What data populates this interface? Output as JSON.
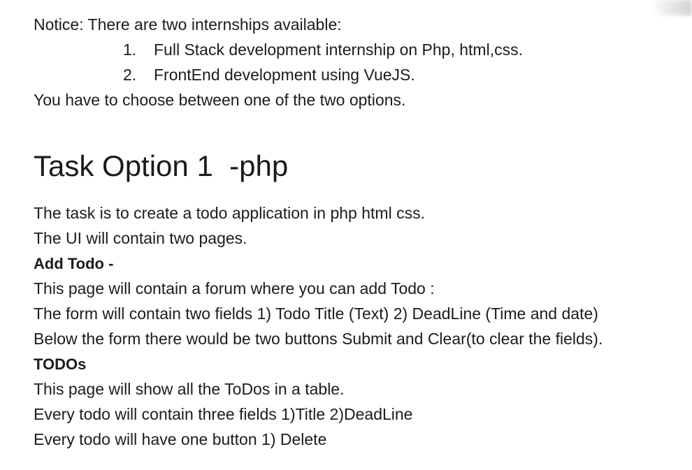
{
  "notice": {
    "intro": "Notice: There are two internships available:",
    "options": [
      {
        "number": "1.",
        "text": "Full Stack development internship on Php, html,css."
      },
      {
        "number": "2.",
        "text": "FrontEnd development using VueJS."
      }
    ],
    "choose": "You have to choose between one of the two options."
  },
  "task": {
    "heading": "Task Option 1  -php",
    "intro_lines": [
      "The task is to create a todo application in php html css.",
      "The UI will contain two pages."
    ],
    "add_todo": {
      "title": "Add Todo -",
      "lines": [
        "This page will contain a forum where you can add Todo :",
        "The form will contain two fields 1) Todo Title (Text) 2) DeadLine (Time and date)",
        "Below the form there would be two buttons Submit and Clear(to clear the fields)."
      ]
    },
    "todos": {
      "title": "TODOs",
      "lines": [
        "This page will show all the ToDos in a table.",
        "Every todo will contain three fields 1)Title 2)DeadLine",
        "Every todo will have one button 1) Delete"
      ]
    }
  }
}
